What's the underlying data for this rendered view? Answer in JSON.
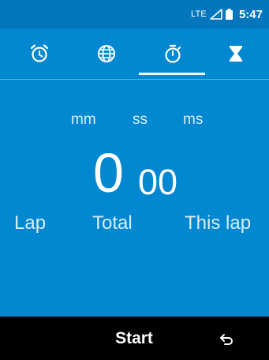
{
  "status_bar": {
    "network": "LTE",
    "time": "5:47",
    "icons": [
      "signal-icon",
      "battery-icon"
    ]
  },
  "tabs": [
    {
      "name": "alarm",
      "icon": "alarm-clock-icon",
      "selected": false
    },
    {
      "name": "world-clock",
      "icon": "globe-icon",
      "selected": false
    },
    {
      "name": "stopwatch",
      "icon": "stopwatch-icon",
      "selected": true
    },
    {
      "name": "timer",
      "icon": "hourglass-icon",
      "selected": false
    }
  ],
  "stopwatch": {
    "units": {
      "minutes": "mm",
      "seconds": "ss",
      "milliseconds": "ms"
    },
    "display_seconds": "0",
    "display_ms": "00",
    "labels": {
      "lap": "Lap",
      "total": "Total",
      "this_lap": "This lap"
    }
  },
  "bottom_bar": {
    "start_label": "Start",
    "back_icon": "back-arrow-icon"
  },
  "colors": {
    "status_bar": "#0277bd",
    "background": "#0288d1",
    "bottom_bar": "#000000",
    "text": "#ffffff"
  }
}
